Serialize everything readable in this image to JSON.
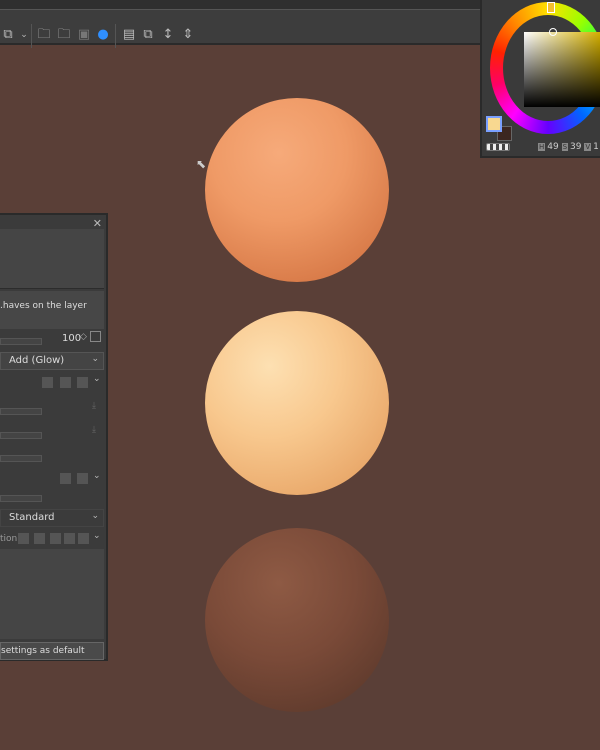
{
  "toolbar": {
    "icons": [
      "transform-icon",
      "open-folder-icon",
      "open-recent-icon",
      "import-icon",
      "color-sets-icon",
      "page-icon",
      "duplicate-icon",
      "expand-vertical-icon",
      "compress-vertical-icon"
    ]
  },
  "color_panel": {
    "h_label": "H",
    "h": "49",
    "s_label": "S",
    "s": "39",
    "v_label": "V",
    "v": "1",
    "main_color": "#f8d890",
    "sub_color": "#3b2620"
  },
  "tool_panel": {
    "description": "haves on the layer.",
    "opacity_value": "100",
    "blend_mode": "Add (Glow)",
    "combine_mode": "Standard",
    "row_label_partial": "tion",
    "footer_button": "settings as default"
  }
}
